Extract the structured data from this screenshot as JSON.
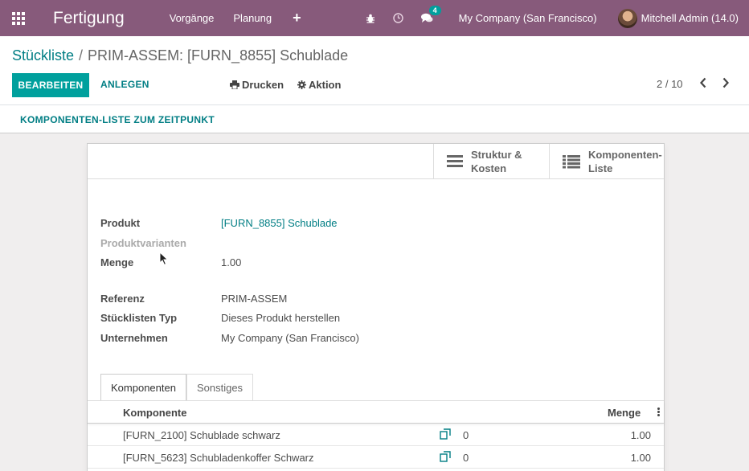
{
  "navbar": {
    "app_title": "Fertigung",
    "menu": [
      "Vorgänge",
      "Planung"
    ],
    "plus_label": "+",
    "messages_badge": "4",
    "company": "My Company (San Francisco)",
    "user": "Mitchell Admin (14.0)",
    "color": "#875a7b"
  },
  "breadcrumb": {
    "parent": "Stückliste",
    "separator": "/",
    "current": "PRIM-ASSEM: [FURN_8855] Schublade"
  },
  "toolbar": {
    "edit_label": "BEARBEITEN",
    "create_label": "ANLEGEN",
    "print_label": "Drucken",
    "action_label": "Aktion",
    "pager": "2 / 10"
  },
  "statusbar": {
    "button_label": "KOMPONENTEN-LISTE ZUM ZEITPUNKT"
  },
  "smart_buttons": [
    {
      "label_1": "Struktur &",
      "label_2": "Kosten",
      "icon": "bars-icon"
    },
    {
      "label_1": "Komponenten-",
      "label_2": "Liste",
      "icon": "list-icon"
    }
  ],
  "fields": {
    "product_label": "Produkt",
    "product_value": "[FURN_8855] Schublade",
    "variants_label": "Produktvarianten",
    "quantity_label": "Menge",
    "quantity_value": "1.00",
    "reference_label": "Referenz",
    "reference_value": "PRIM-ASSEM",
    "bom_type_label": "Stücklisten Typ",
    "bom_type_value": "Dieses Produkt herstellen",
    "company_label": "Unternehmen",
    "company_value": "My Company (San Francisco)"
  },
  "tabs": [
    "Komponenten",
    "Sonstiges"
  ],
  "table": {
    "columns": {
      "component": "Komponente",
      "quantity": "Menge"
    },
    "rows": [
      {
        "component": "[FURN_2100] Schublade schwarz",
        "available": "0",
        "quantity": "1.00"
      },
      {
        "component": "[FURN_5623] Schubladenkoffer Schwarz",
        "available": "0",
        "quantity": "1.00"
      }
    ]
  },
  "colors": {
    "primary": "#00a09d",
    "link": "#017e84"
  }
}
